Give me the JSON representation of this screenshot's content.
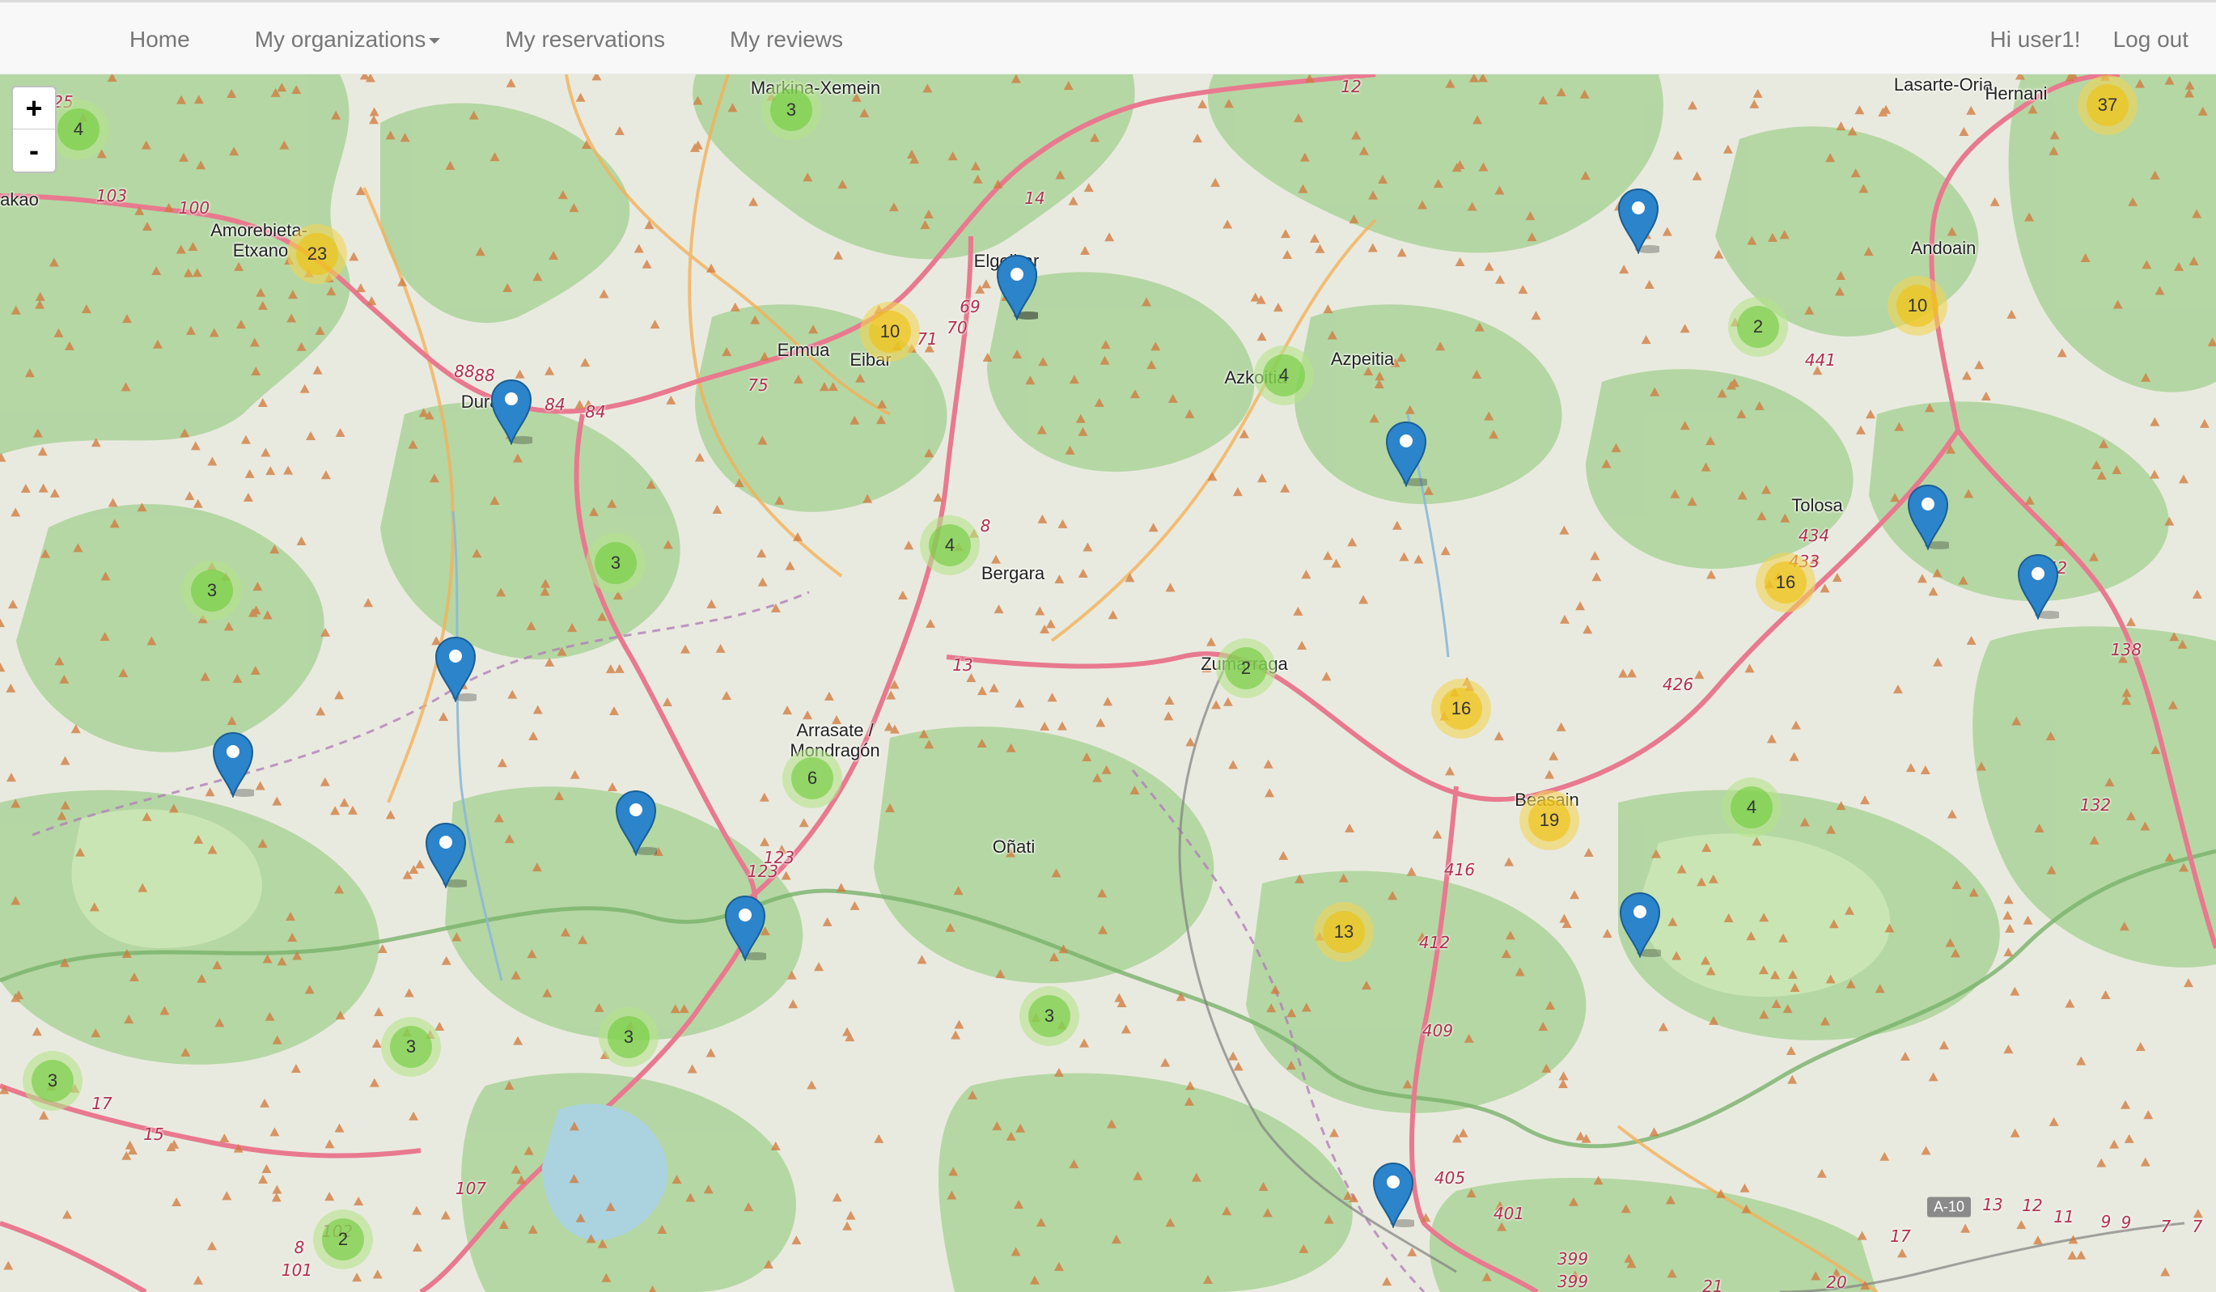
{
  "navbar": {
    "home": "Home",
    "organizations": "My organizations",
    "reservations": "My reservations",
    "reviews": "My reviews",
    "greeting": "Hi user1!",
    "logout": "Log out"
  },
  "map": {
    "zoom_in": "+",
    "zoom_out": "-",
    "clusters": [
      {
        "count": "4",
        "size": "small"
      },
      {
        "count": "3",
        "size": "small"
      },
      {
        "count": "37",
        "size": "medium"
      },
      {
        "count": "23",
        "size": "medium"
      },
      {
        "count": "10",
        "size": "medium"
      },
      {
        "count": "4",
        "size": "small"
      },
      {
        "count": "2",
        "size": "small"
      },
      {
        "count": "10",
        "size": "medium"
      },
      {
        "count": "3",
        "size": "small"
      },
      {
        "count": "4",
        "size": "small"
      },
      {
        "count": "16",
        "size": "medium"
      },
      {
        "count": "3",
        "size": "small"
      },
      {
        "count": "2",
        "size": "small"
      },
      {
        "count": "16",
        "size": "medium"
      },
      {
        "count": "6",
        "size": "small"
      },
      {
        "count": "19",
        "size": "medium"
      },
      {
        "count": "4",
        "size": "small"
      },
      {
        "count": "13",
        "size": "medium"
      },
      {
        "count": "3",
        "size": "small"
      },
      {
        "count": "3",
        "size": "small"
      },
      {
        "count": "3",
        "size": "small"
      },
      {
        "count": "3",
        "size": "small"
      },
      {
        "count": "2",
        "size": "small"
      }
    ],
    "markers": 14,
    "places": [
      "Markina-Xemein",
      "Lasarte-Oria",
      "Hernani",
      "akao",
      "Amorebieta-",
      "Etxano",
      "Elgoibar",
      "Andoain",
      "Ermua",
      "Eibar",
      "Azkoitia",
      "Azpeitia",
      "Durango",
      "Tolosa",
      "Bergara",
      "Zumarraga",
      "Arrasate /",
      "Mondragón",
      "Beasain",
      "Oñati"
    ],
    "roads": [
      "12",
      "14",
      "103",
      "100",
      "69",
      "71",
      "70",
      "441",
      "88",
      "88",
      "84",
      "84",
      "75",
      "434",
      "433",
      "8",
      "142",
      "138",
      "13",
      "426",
      "123",
      "123",
      "416",
      "132",
      "412",
      "409",
      "17",
      "15",
      "405",
      "401",
      "107",
      "8",
      "102",
      "101",
      "399",
      "399",
      "21",
      "20",
      "17",
      "13",
      "12",
      "11",
      "9",
      "9",
      "7",
      "7",
      "25"
    ],
    "shield": "A-10"
  }
}
